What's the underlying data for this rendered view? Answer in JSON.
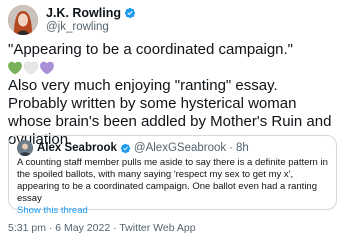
{
  "author": {
    "name": "J.K. Rowling",
    "handle": "@jk_rowling"
  },
  "tweet": {
    "line1": "\"Appearing to be a coordinated campaign.\"",
    "hearts": [
      "green-heart",
      "white-heart",
      "purple-heart"
    ],
    "line2": "Also very much enjoying \"ranting\" essay. Probably written by some hysterical woman whose brain's been addled by Mother's Ruin and ovulation."
  },
  "quote": {
    "name": "Alex Seabrook",
    "handle": "@AlexGSeabrook",
    "separator": "·",
    "age": "8h",
    "text": "A counting staff member pulls me aside to say there is a definite pattern in the spoiled ballots, with many saying 'respect my sex to get my x', appearing to be a coordinated campaign. One ballot even had a ranting essay",
    "show_thread": "Show this thread"
  },
  "footer": {
    "time": "5:31 pm",
    "separator1": "·",
    "date": "6 May 2022",
    "separator2": "·",
    "source": "Twitter Web App"
  },
  "colors": {
    "verified": "#1d9bf0",
    "heart_green": "#78b159",
    "heart_white": "#e6e7e8",
    "heart_purple": "#aa8ed6"
  }
}
